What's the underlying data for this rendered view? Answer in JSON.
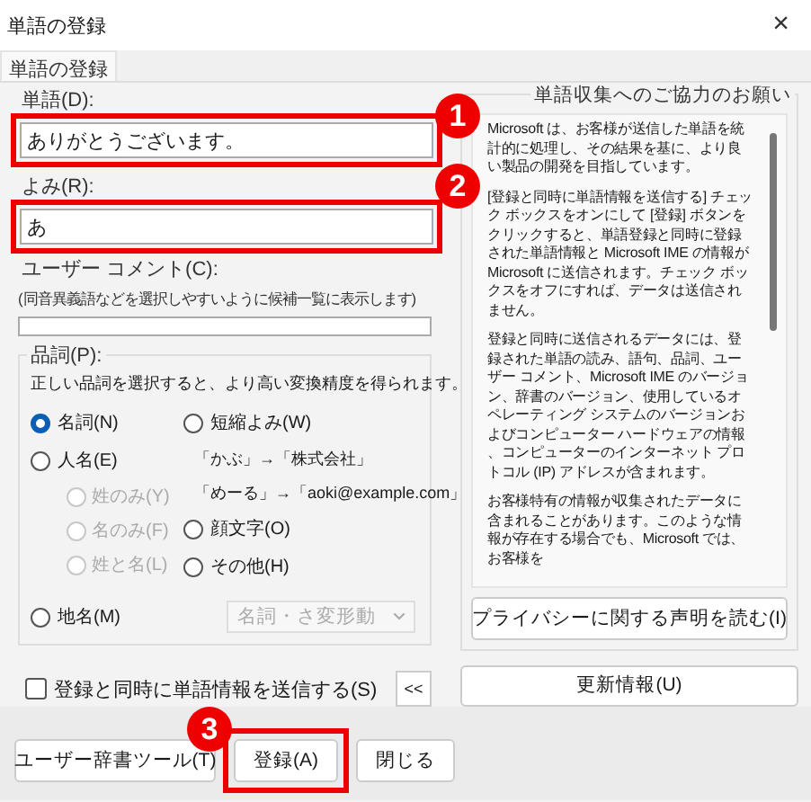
{
  "window": {
    "title": "単語の登録",
    "close": "×"
  },
  "tabs": [
    {
      "label": "単語の登録",
      "selected": true
    }
  ],
  "word": {
    "label": "単語(D):",
    "value": "ありがとうございます。",
    "highlighted": true
  },
  "reading": {
    "label": "よみ(R):",
    "value": "あ",
    "highlighted": true
  },
  "comment": {
    "label": "ユーザー コメント(C):",
    "hint": "(同音異義語などを選択しやすいように候補一覧に表示します)"
  },
  "part_of_speech": {
    "label": "品詞(P):",
    "description": "正しい品詞を選択すると、より高い変換精度を得られます。",
    "left": [
      {
        "kind": "radio",
        "label": "名詞(N)",
        "selected": true,
        "disabled": false
      },
      {
        "kind": "radio",
        "label": "人名(E)",
        "selected": false,
        "disabled": false
      },
      {
        "kind": "sub_radio",
        "label": "姓のみ(Y)",
        "selected": false,
        "disabled": true
      },
      {
        "kind": "sub_radio",
        "label": "名のみ(F)",
        "selected": false,
        "disabled": true
      },
      {
        "kind": "sub_radio",
        "label": "姓と名(L)",
        "selected": false,
        "disabled": true
      }
    ],
    "right": [
      {
        "kind": "radio",
        "label": "短縮よみ(W)",
        "selected": false,
        "disabled": false
      },
      {
        "kind": "example",
        "label": "「かぶ」→「株式会社」"
      },
      {
        "kind": "example",
        "label": "「めーる」→「aoki@example.com」"
      },
      {
        "kind": "radio",
        "label": "顔文字(O)",
        "selected": false,
        "disabled": false
      },
      {
        "kind": "radio",
        "label": "その他(H)",
        "selected": false,
        "disabled": false
      }
    ],
    "place": {
      "label": "地名(M)",
      "selected": false,
      "dropdown": "名詞・さ変形動",
      "dropdown_disabled": true
    }
  },
  "send_checkbox": {
    "label": "登録と同時に単語情報を送信する(S)",
    "checked": false
  },
  "collapse_button": "<<",
  "info_panel": {
    "title": "単語収集へのご協力のお願い",
    "paragraphs": [
      "Microsoft は、お客様が送信した単語を統計的に処理し、その結果を基に、より良い製品の開発を目指しています。",
      "[登録と同時に単語情報を送信する] チェック ボックスをオンにして [登録] ボタンをクリックすると、単語登録と同時に登録された単語情報と Microsoft IME の情報が Microsoft に送信されます。チェック ボックスをオフにすれば、データは送信されません。",
      "登録と同時に送信されるデータには、登録された単語の読み、語句、品詞、ユーザー コメント、Microsoft IME のバージョン、辞書のバージョン、使用しているオペレーティング システムのバージョンおよびコンピューター ハードウェアの情報、コンピューターのインターネット プロトコル (IP) アドレスが含まれます。",
      "お客様特有の情報が収集されたデータに含まれることがあります。このような情報が存在する場合でも、Microsoft では、お客様を"
    ],
    "privacy_button": "プライバシーに関する声明を読む(I)"
  },
  "update_button": "更新情報(U)",
  "footer_buttons": [
    {
      "label": "ユーザー辞書ツール(T)",
      "highlighted": false
    },
    {
      "label": "登録(A)",
      "highlighted": true
    },
    {
      "label": "閉じる",
      "highlighted": false
    }
  ],
  "badges": [
    {
      "number": "1"
    },
    {
      "number": "2"
    },
    {
      "number": "3"
    }
  ]
}
